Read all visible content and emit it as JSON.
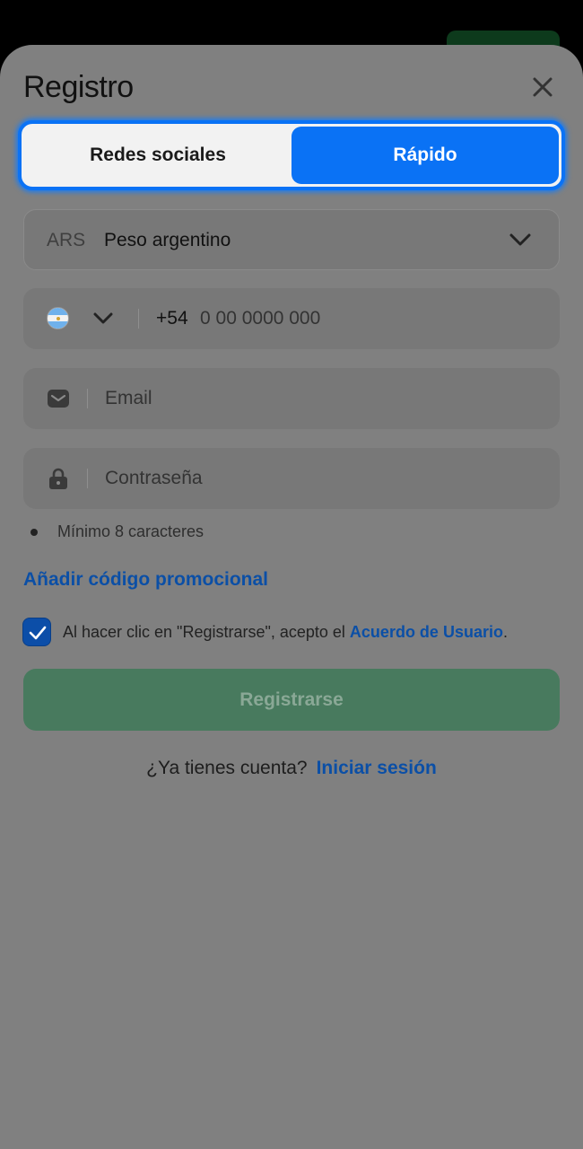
{
  "modal": {
    "title": "Registro"
  },
  "tabs": [
    {
      "label": "Redes sociales",
      "active": false
    },
    {
      "label": "Rápido",
      "active": true
    }
  ],
  "currency": {
    "code": "ARS",
    "name": "Peso argentino"
  },
  "phone": {
    "prefix": "+54",
    "placeholder": "0 00 0000 000",
    "country_flag": "argentina-flag-icon"
  },
  "email": {
    "placeholder": "Email"
  },
  "password": {
    "placeholder": "Contraseña",
    "rule": "Mínimo 8 caracteres"
  },
  "promo": {
    "label": "Añadir código promocional"
  },
  "agreement": {
    "checked": true,
    "text": "Al hacer clic en \"Registrarse\", acepto el ",
    "link": "Acuerdo de Usuario",
    "suffix": "."
  },
  "register": {
    "label": "Registrarse"
  },
  "login": {
    "question": "¿Ya tienes cuenta?",
    "link": "Iniciar sesión"
  },
  "colors": {
    "accent": "#0a72f5",
    "link": "#0b4fa6",
    "register_bg": "#487a5e",
    "overlay": "#808080"
  }
}
